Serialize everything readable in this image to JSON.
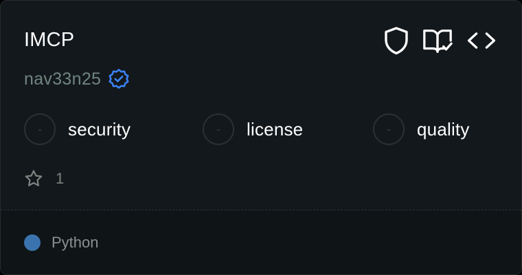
{
  "card": {
    "title": "IMCP",
    "author": "nav33n25",
    "actions": [
      "shield-icon",
      "book-check-icon",
      "code-icon"
    ],
    "metrics": [
      {
        "value": "-",
        "label": "security"
      },
      {
        "value": "-",
        "label": "license"
      },
      {
        "value": "-",
        "label": "quality"
      }
    ],
    "stars": "1",
    "language": {
      "name": "Python",
      "color": "#3a73ad"
    }
  },
  "colors": {
    "background": "#13181c",
    "border": "#262b30",
    "author": "#71857f",
    "verified": "#3b82f6",
    "text": "#ffffff"
  }
}
